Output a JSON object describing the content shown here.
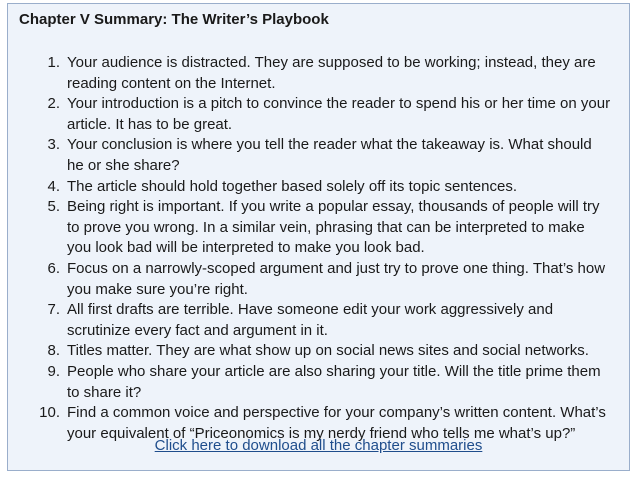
{
  "summary": {
    "title": "Chapter V Summary: The Writer’s Playbook",
    "items": [
      {
        "number": "1.",
        "text": "Your audience is distracted. They are supposed to be working; instead, they are reading content on the Internet."
      },
      {
        "number": "2.",
        "text": "Your introduction is a pitch to convince the reader to spend his or her time on your article. It has to be great."
      },
      {
        "number": "3.",
        "text": "Your conclusion is where you tell the reader what the takeaway is. What should he or she share?"
      },
      {
        "number": "4.",
        "text": "The article should hold together based solely off its topic sentences."
      },
      {
        "number": "5.",
        "text": "Being right is important. If you write a popular essay, thousands of people will try to prove you wrong. In a similar vein, phrasing that can be interpreted to make you look bad will be interpreted to make you look bad."
      },
      {
        "number": "6.",
        "text": "Focus on a narrowly-scoped argument and just try to prove one thing. That’s how you make sure you’re right."
      },
      {
        "number": "7.",
        "text": "All first drafts are terrible. Have someone edit your work aggressively and scrutinize every fact and argument in it."
      },
      {
        "number": "8.",
        "text": "Titles matter. They are what show up on social news sites and social networks."
      },
      {
        "number": "9.",
        "text": "People who share your article are also sharing your title. Will the title prime them to share it?"
      },
      {
        "number": "10.",
        "text": "Find a common voice and perspective for your company’s written content. What’s your equivalent of “Priceonomics is my nerdy friend who tells me what’s up?”"
      }
    ],
    "download_link": "Click here to download all the chapter summaries"
  },
  "colors": {
    "box_background": "#eef3fa",
    "box_border": "#9aaecb",
    "link": "#1f4d8c",
    "text": "#1a1a1a"
  }
}
